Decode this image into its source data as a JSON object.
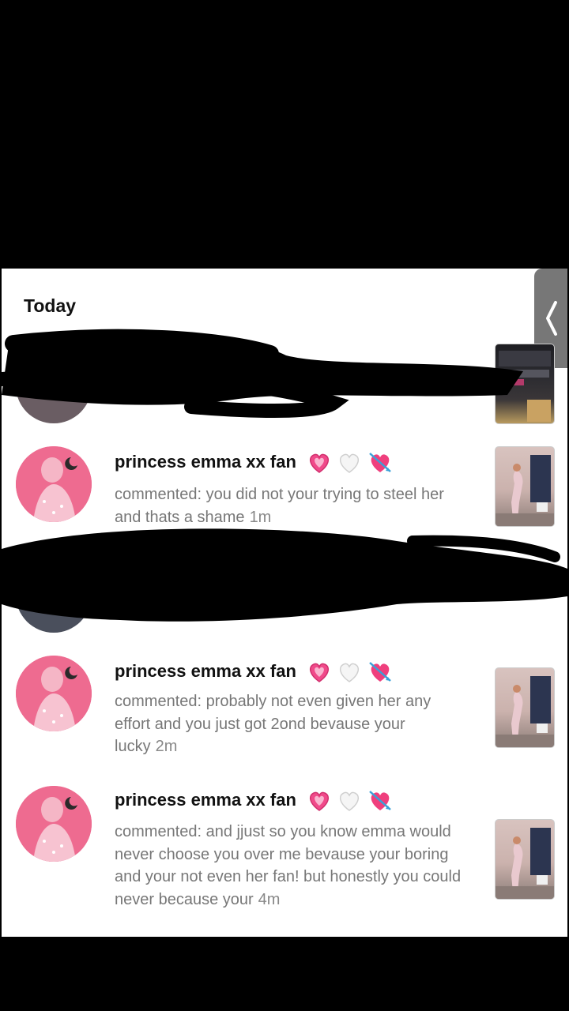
{
  "section": {
    "title": "Today"
  },
  "notifications": [
    {
      "username": "princess emma xx fan",
      "text": "commented: you did not your trying to steel her and thats a shame",
      "time": "1m"
    },
    {
      "username": "princess emma xx fan",
      "text": "commented: probably not even given her any effort and you just got 2ond bevause your lucky",
      "time": "2m"
    },
    {
      "username": "princess emma xx fan",
      "text": "commented: and jjust so you know emma would never choose you over me bevause your boring and your not even her fan! but honestly you could never because your",
      "time": "4m"
    }
  ],
  "icons": {
    "heart1": "sparkling-pink-heart-icon",
    "heart2": "white-heart-icon",
    "heart3": "heart-with-arrow-icon",
    "handle": "chevron-left-icon"
  },
  "colors": {
    "accent_pink": "#ea5c86",
    "username": "#111111",
    "comment": "#777777"
  }
}
